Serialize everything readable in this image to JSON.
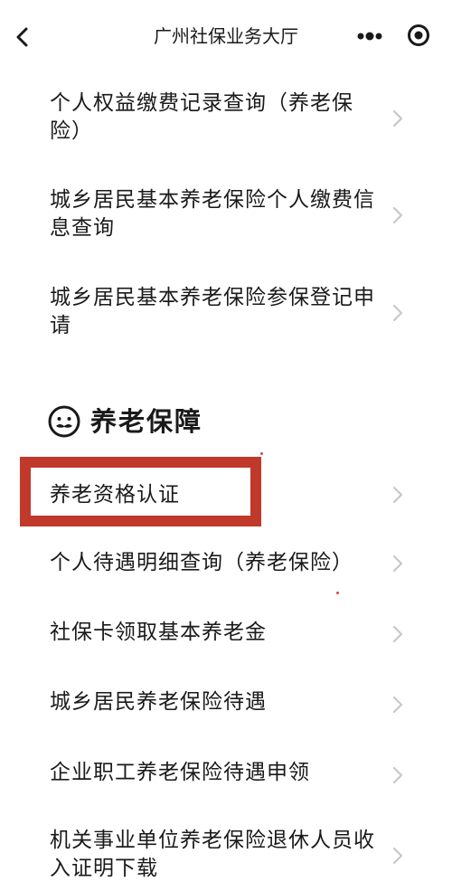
{
  "header": {
    "title": "广州社保业务大厅",
    "back_icon": "chevron-left-icon",
    "more_icon": "more-dots-icon",
    "close_icon": "target-icon"
  },
  "top_items": [
    {
      "label": "个人权益缴费记录查询（养老保险）"
    },
    {
      "label": "城乡居民基本养老保险个人缴费信息查询"
    },
    {
      "label": "城乡居民基本养老保险参保登记申请"
    }
  ],
  "section": {
    "title": "养老保障",
    "icon": "elderly-face-icon"
  },
  "section_items": [
    {
      "label": "养老资格认证"
    },
    {
      "label": "个人待遇明细查询（养老保险）"
    },
    {
      "label": "社保卡领取基本养老金"
    },
    {
      "label": "城乡居民养老保险待遇"
    },
    {
      "label": "企业职工养老保险待遇申领"
    },
    {
      "label": "机关事业单位养老保险退休人员收入证明下载"
    }
  ],
  "colors": {
    "highlight": "#c0392b",
    "chevron": "#c8c8c8",
    "text": "#1a1a1a"
  }
}
